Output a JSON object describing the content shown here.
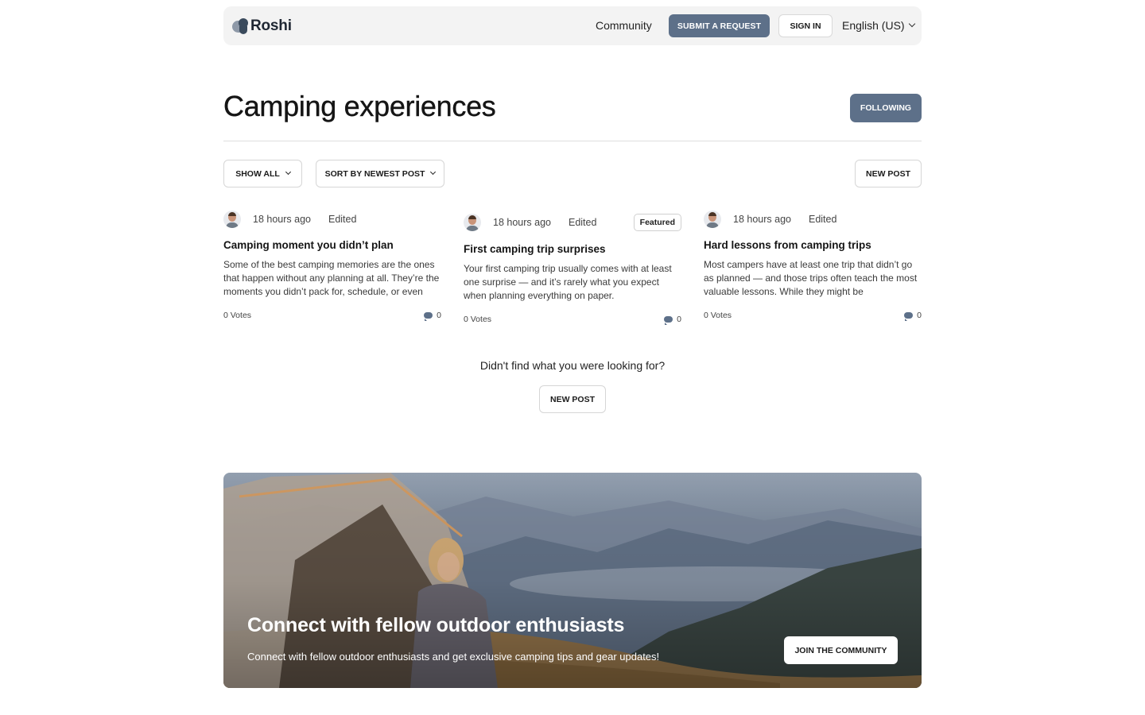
{
  "header": {
    "logo_text": "Roshi",
    "nav_community": "Community",
    "submit_label": "SUBMIT A REQUEST",
    "signin_label": "SIGN IN",
    "language": "English (US)"
  },
  "page": {
    "title": "Camping experiences",
    "following_label": "FOLLOWING"
  },
  "filters": {
    "show_label": "SHOW ALL",
    "sort_label": "SORT BY NEWEST POST",
    "new_post_label": "NEW POST"
  },
  "posts": [
    {
      "time": "18 hours ago",
      "edited": "Edited",
      "title": "Camping moment you didn’t plan",
      "excerpt": "Some of the best camping memories are the ones that happen without any planning at all. They’re the moments you didn’t pack for, schedule, or even",
      "votes": "0 Votes",
      "comments": "0"
    },
    {
      "time": "18 hours ago",
      "edited": "Edited",
      "badge": "Featured",
      "title": "First camping trip surprises",
      "excerpt": "Your first camping trip usually comes with at least one surprise — and it’s rarely what you expect when planning everything on paper.",
      "votes": "0 Votes",
      "comments": "0"
    },
    {
      "time": "18 hours ago",
      "edited": "Edited",
      "title": "Hard lessons from camping trips",
      "excerpt": "Most campers have at least one trip that didn’t go as planned — and those trips often teach the most valuable lessons. While they might be",
      "votes": "0 Votes",
      "comments": "0"
    }
  ],
  "not_found": {
    "text": "Didn't find what you were looking for?",
    "button_label": "NEW POST"
  },
  "banner": {
    "title": "Connect with fellow outdoor enthusiasts",
    "subtitle": "Connect with fellow outdoor enthusiasts and get exclusive camping tips and gear updates!",
    "button_label": "JOIN THE COMMUNITY"
  },
  "colors": {
    "accent": "#5d7089",
    "header_bg": "#f3f3f3"
  }
}
